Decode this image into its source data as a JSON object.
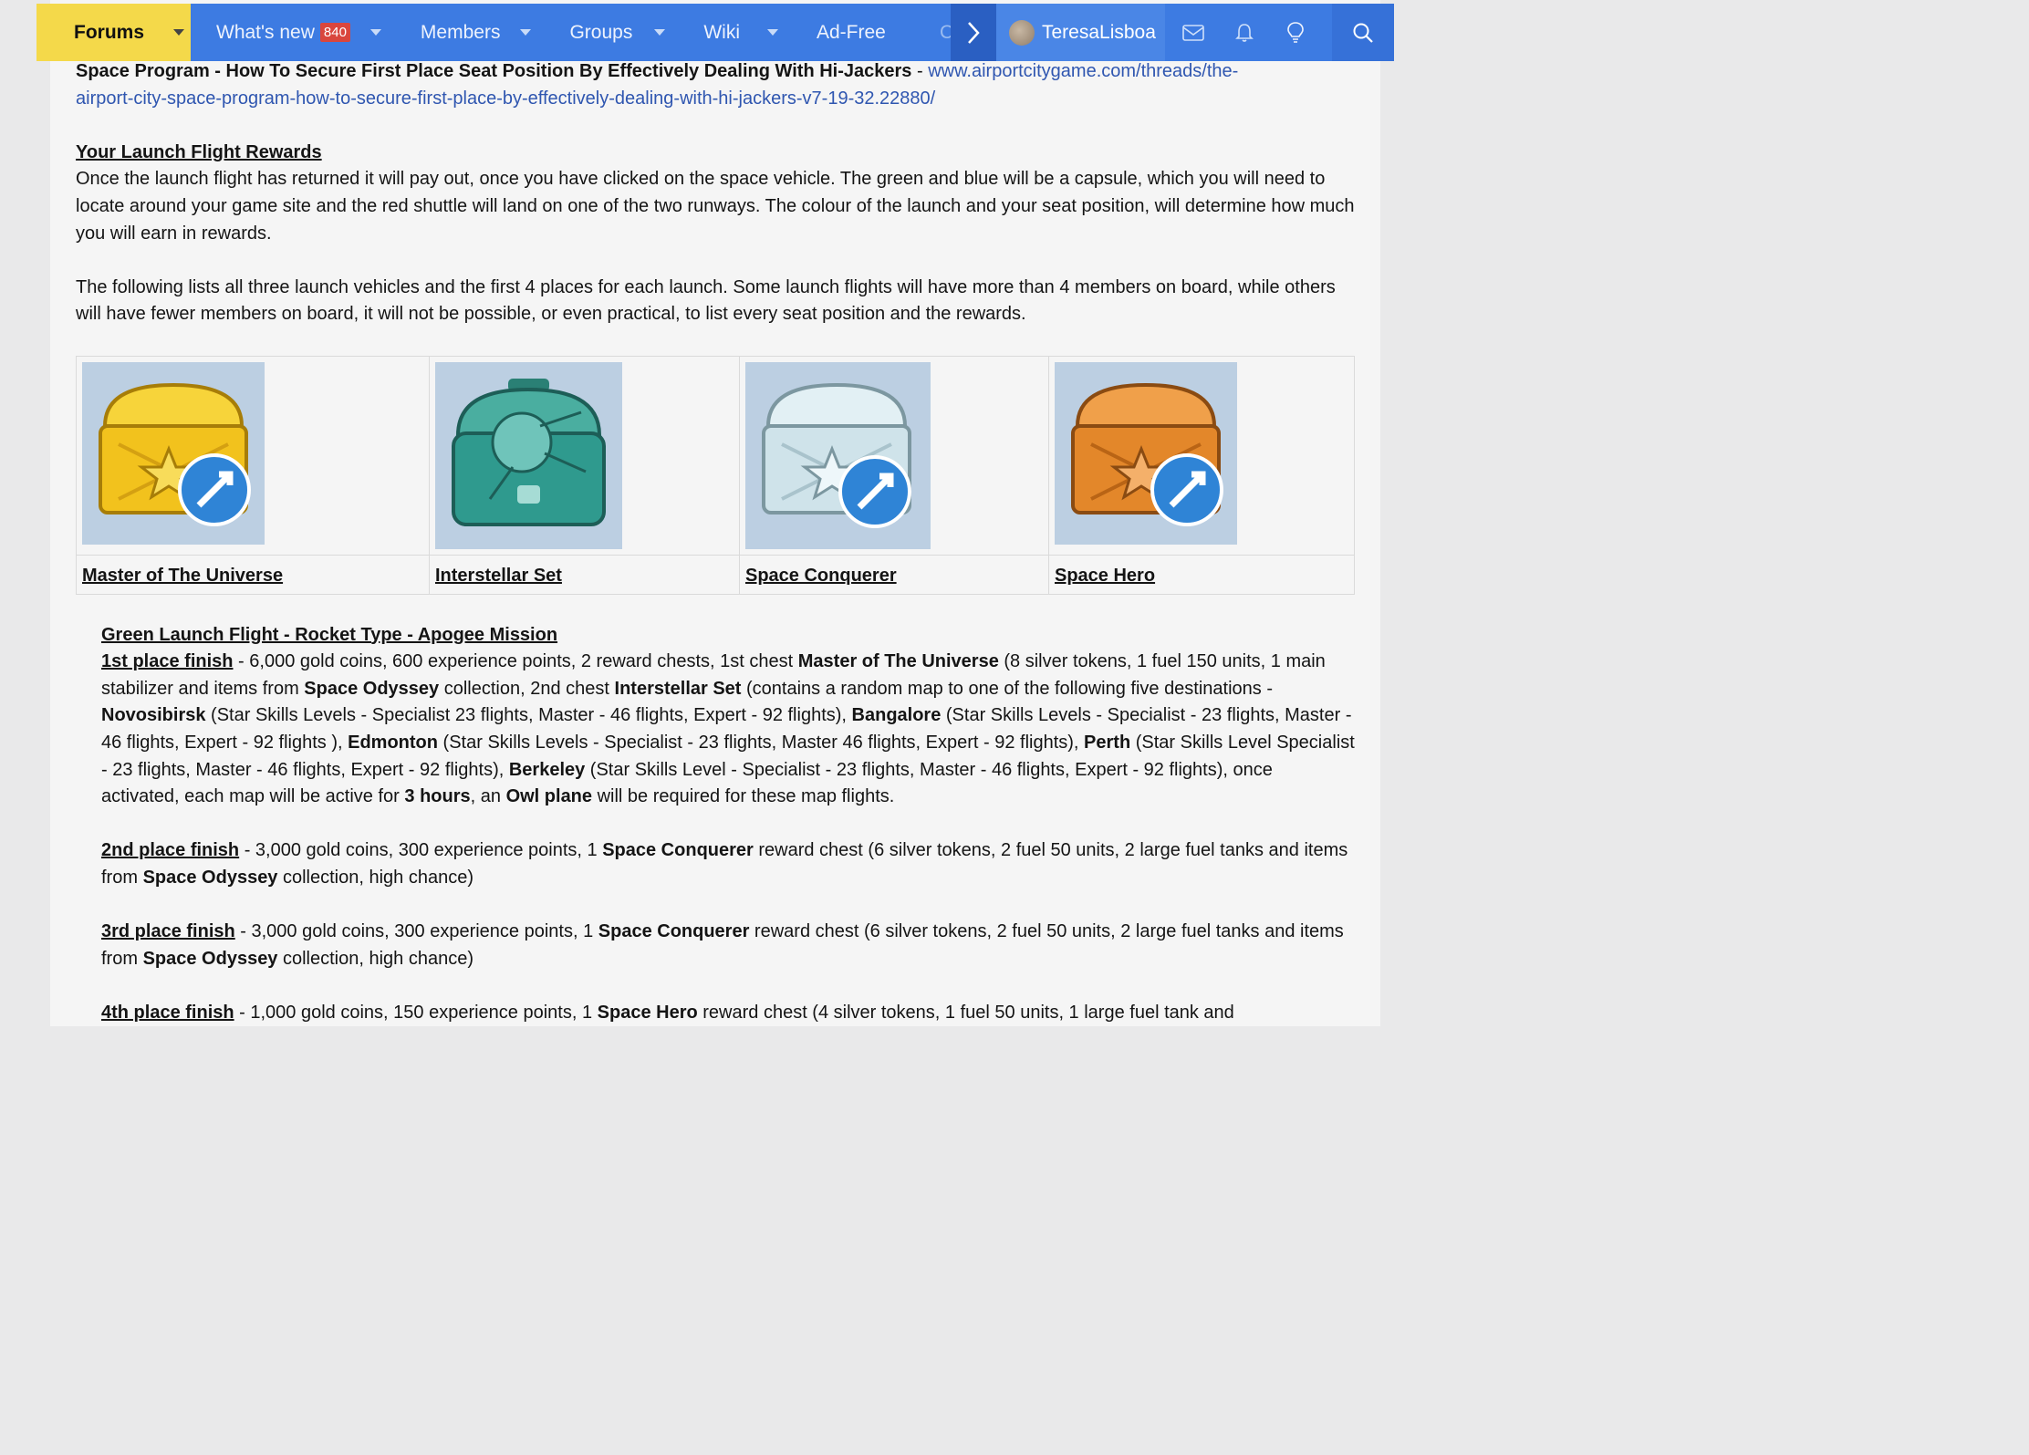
{
  "nav": {
    "forums": "Forums",
    "whats_new": "What's new",
    "whats_new_count": "840",
    "members": "Members",
    "groups": "Groups",
    "wiki": "Wiki",
    "ad_free": "Ad-Free",
    "overflow_hint": "C",
    "username": "TeresaLisboa"
  },
  "article": {
    "hijack_title": "Space Program - How To Secure First Place Seat Position By Effectively Dealing With Hi-Jackers",
    "hijack_dash": " - ",
    "hijack_url_1": "www.airportcitygame.com/threads/the-",
    "hijack_url_2": "airport-city-space-program-how-to-secure-first-place-by-effectively-dealing-with-hi-jackers-v7-19-32.22880/",
    "rewards_heading": "Your Launch Flight Rewards",
    "rewards_text": "Once the launch flight has returned it will pay out, once you have clicked on the space vehicle. The green and blue will be a capsule, which you will need to locate around your game site and the red shuttle will land on one of the two runways. The colour of the launch and your seat position, will determine how much you will earn in rewards.",
    "lists_text": "The following lists all three launch vehicles and the first 4 places for each launch. Some launch flights will have more than 4 members on board, while others will have fewer members on board, it will not be possible, or even practical, to list every seat position and the rewards."
  },
  "chests": [
    {
      "name": "Master of The Universe",
      "color": "#f2c21d"
    },
    {
      "name": "Interstellar Set",
      "color": "#2f9a8e"
    },
    {
      "name": "Space Conquerer",
      "color": "#cfe3ea"
    },
    {
      "name": "Space Hero",
      "color": "#e3872a"
    }
  ],
  "green_flight": {
    "heading": "Green Launch Flight - Rocket Type - Apogee Mission",
    "p1_label": "1st place finish",
    "p1_t1": " - 6,000 gold coins, 600 experience points, 2 reward chests, 1st chest ",
    "p1_b1": "Master of The Universe",
    "p1_t2": " (8 silver tokens, 1 fuel 150 units, 1 main stabilizer and items from ",
    "p1_b2": "Space Odyssey",
    "p1_t3": " collection, 2nd chest ",
    "p1_b3": "Interstellar Set",
    "p1_t4": " (contains a random map to one of the following five destinations - ",
    "p1_b4": "Novosibirsk",
    "p1_t5": " (Star Skills Levels - Specialist 23 flights, Master - 46 flights, Expert - 92 flights), ",
    "p1_b5": "Bangalore",
    "p1_t6": " (Star Skills Levels - Specialist - 23 flights, Master - 46 flights, Expert - 92 flights ), ",
    "p1_b6": "Edmonton",
    "p1_t7": " (Star Skills Levels - Specialist - 23 flights, Master 46 flights, Expert - 92 flights), ",
    "p1_b7": "Perth",
    "p1_t8": " (Star Skills Level Specialist - 23 flights, Master - 46 flights, Expert - 92 flights), ",
    "p1_b8": "Berkeley",
    "p1_t9": " (Star Skills Level - Specialist - 23 flights, Master - 46 flights, Expert - 92 flights), once activated, each map will be active for ",
    "p1_b9": "3 hours",
    "p1_t10": ", an ",
    "p1_b10": "Owl plane",
    "p1_t11": " will be required for these map flights.",
    "p2_label": "2nd place finish",
    "p2_t1": " - 3,000 gold coins, 300 experience points, 1 ",
    "p2_b1": "Space Conquerer",
    "p2_t2": " reward chest (6 silver tokens, 2 fuel 50 units, 2 large fuel tanks and items from ",
    "p2_b2": "Space Odyssey",
    "p2_t3": " collection, high chance)",
    "p3_label": "3rd place finish",
    "p3_t1": " - 3,000 gold coins, 300 experience points, 1 ",
    "p3_b1": "Space Conquerer",
    "p3_t2": " reward chest (6 silver tokens, 2 fuel 50 units, 2 large fuel tanks and items from ",
    "p3_b2": "Space Odyssey",
    "p3_t3": " collection, high chance)",
    "p4_label": "4th place finish",
    "p4_t1": " - 1,000 gold coins, 150 experience points, 1 ",
    "p4_b1": "Space Hero",
    "p4_t2": " reward chest (4 silver tokens, 1 fuel 50 units, 1 large fuel tank and"
  }
}
